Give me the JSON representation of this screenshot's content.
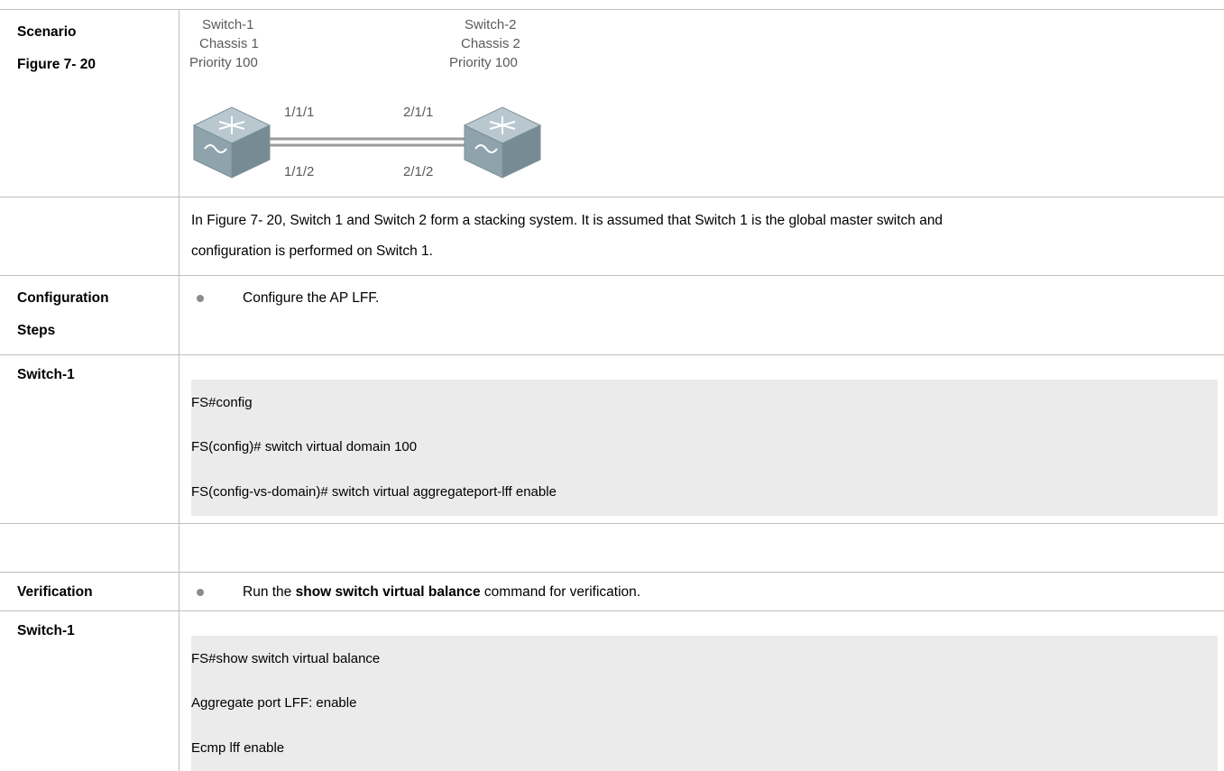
{
  "rows": {
    "scenario_label": "Scenario",
    "figure_label": "Figure 7- 20",
    "description_line1": "In Figure 7- 20, Switch 1 and Switch 2 form a stacking system. It is assumed that Switch 1 is the global master switch and",
    "description_line2": "configuration is performed on Switch 1.",
    "config_label_line1": "Configuration",
    "config_label_line2": "Steps",
    "config_step": "Configure the AP LFF.",
    "switch1_label_a": "Switch-1",
    "config_commands": [
      "FS#config",
      "FS(config)# switch virtual domain 100",
      "FS(config-vs-domain)# switch virtual aggregateport-lff enable"
    ],
    "verification_label": "Verification",
    "verify_prefix": "Run the ",
    "verify_command": "show switch virtual balance",
    "verify_suffix": " command for verification.",
    "switch1_label_b": "Switch-1",
    "verify_output": [
      "FS#show switch virtual balance",
      "Aggregate port LFF: enable",
      "Ecmp lff enable"
    ]
  },
  "diagram": {
    "switch1": {
      "name": "Switch-1",
      "chassis": "Chassis 1",
      "priority": "Priority 100"
    },
    "switch2": {
      "name": "Switch-2",
      "chassis": "Chassis 2",
      "priority": "Priority 100"
    },
    "ports": {
      "s1_top": "1/1/1",
      "s1_bottom": "1/1/2",
      "s2_top": "2/1/1",
      "s2_bottom": "2/1/2"
    },
    "colors": {
      "switch_body": "#8fa3ad",
      "switch_top": "#b9c8cf",
      "link": "#9a9a9a"
    }
  }
}
